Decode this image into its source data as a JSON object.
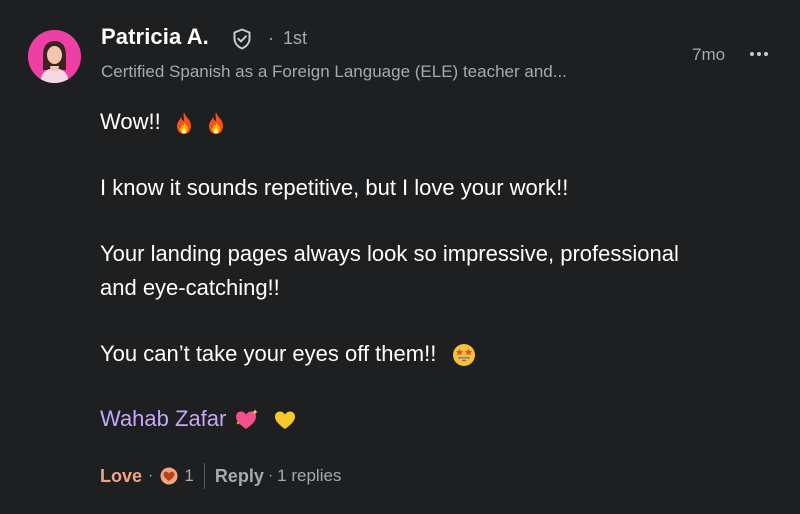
{
  "comment": {
    "author_name": "Patricia A.",
    "degree": "1st",
    "headline": "Certified Spanish as a Foreign Language (ELE) teacher and...",
    "timestamp": "7mo",
    "lines": [
      "Wow!!",
      "I know it sounds repetitive, but I love your work!!",
      "Your landing pages always look so impressive, professional",
      "and eye-catching!!",
      "You can’t take your eyes off them!!"
    ],
    "mention": "Wahab Zafar",
    "icons": {
      "verified": "shield-check-icon",
      "more": "more-horizontal-icon",
      "fire": "fire-emoji",
      "star_eyes": "star-struck-emoji",
      "sparkling_heart": "sparkling-heart-emoji",
      "yellow_heart": "yellow-heart-emoji",
      "love_reaction": "heart-reaction-icon"
    }
  },
  "footer": {
    "love_label": "Love",
    "dot": "·",
    "reaction_count": "1",
    "reply_label": "Reply",
    "replies_text": "1 replies"
  },
  "colors": {
    "background": "#1d1f21",
    "text_primary": "#ffffff",
    "text_secondary": "#a7a9ab",
    "mention": "#c6a7f5",
    "love": "#f2a384",
    "avatar_bg": "#ee3fa4"
  }
}
